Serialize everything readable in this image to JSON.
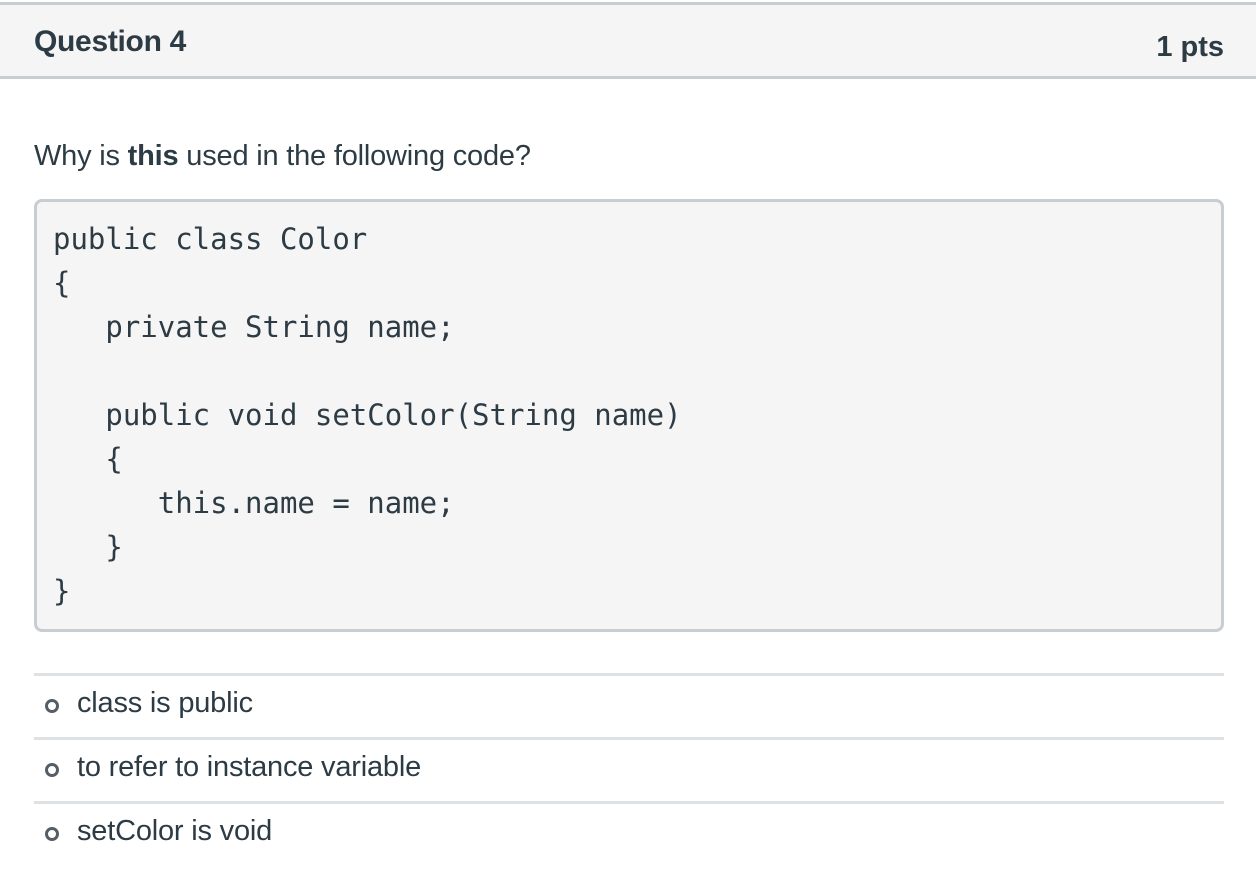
{
  "question": {
    "title": "Question 4",
    "points": "1 pts",
    "prompt_before": "Why is ",
    "prompt_bold": "this",
    "prompt_after": " used in the following code?",
    "code": "public class Color\n{\n   private String name;\n\n   public void setColor(String name)\n   {\n      this.name = name;\n   }\n}"
  },
  "answers": [
    {
      "label": "class is public"
    },
    {
      "label": "to refer to instance variable"
    },
    {
      "label": "setColor is void"
    }
  ]
}
